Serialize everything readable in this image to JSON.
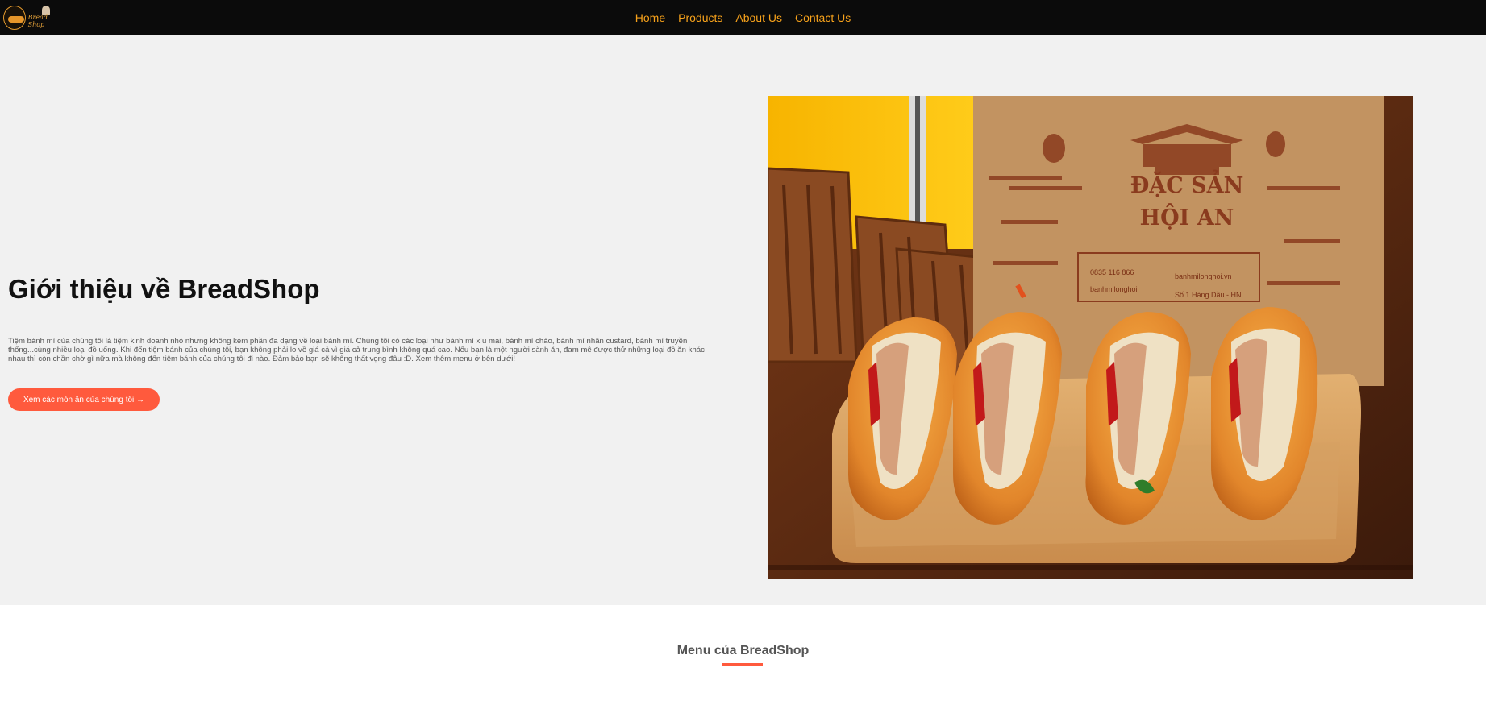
{
  "logo": {
    "text": "Bread Shop",
    "icon": "bread-logo-icon"
  },
  "nav": {
    "items": [
      "Home",
      "Products",
      "About Us",
      "Contact Us"
    ]
  },
  "hero": {
    "title": "Giới thiệu về BreadShop",
    "description": "Tiệm bánh mì của chúng tôi là tiệm kinh doanh nhỏ nhưng không kém phần đa dạng về loại bánh mì. Chúng tôi có các loại như bánh mì xíu mại, bánh mì chảo, bánh mì nhân custard, bánh mì truyền thống...cùng nhiều loại đồ uống. Khi đến tiệm bánh của chúng tôi, bạn không phải lo về giá cả vì giá cả trung bình không quá cao. Nếu bạn là một người sành ăn, đam mê được thử những loại đồ ăn khác nhau thì còn chần chờ gì nữa mà không đến tiệm bánh của chúng tôi đi nào. Đảm bảo bạn sẽ không thất vọng đâu :D. Xem thêm menu ở bên dưới!",
    "button_label": "Xem các món ăn của chúng tôi →",
    "image": {
      "bag_title_line1": "ĐẶC SẢN",
      "bag_title_line2": "HỘI AN",
      "phone": "0835 116 866",
      "facebook": "banhmilonghoi",
      "website": "banhmilonghoi.vn",
      "address": "Số 1 Hàng Dầu - HN"
    }
  },
  "menu": {
    "title": "Menu của BreadShop"
  },
  "colors": {
    "accent": "#ff5a3d",
    "nav_link": "#f7a21b",
    "nav_bg": "#0b0b0b"
  }
}
